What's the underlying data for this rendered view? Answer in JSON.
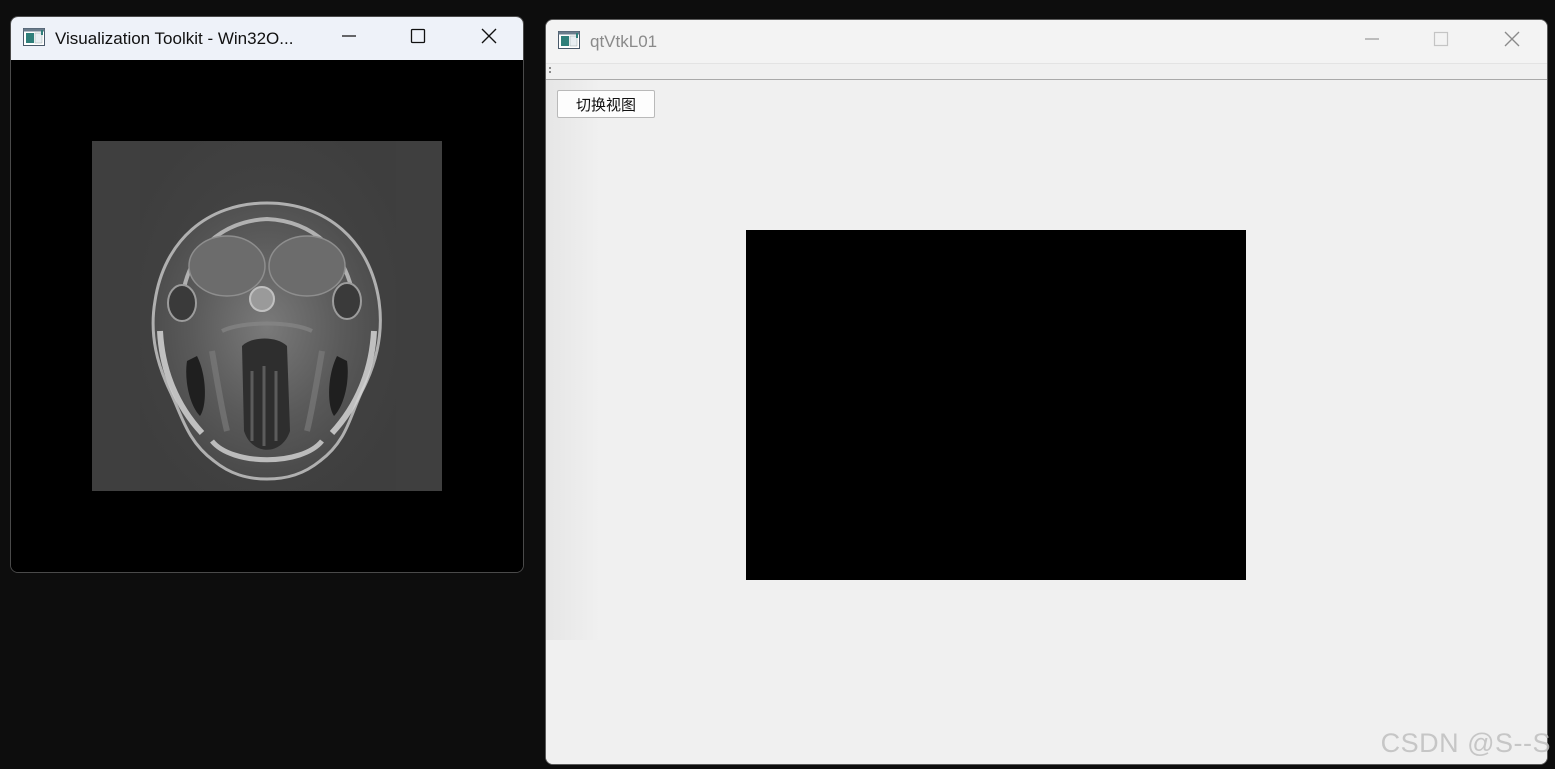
{
  "vtk_window": {
    "title": "Visualization Toolkit - Win32O...",
    "icon": "app-window-icon",
    "controls": {
      "minimize_icon": "minimize-icon",
      "maximize_icon": "maximize-icon",
      "close_icon": "close-icon"
    },
    "render_view": {
      "content": "MRI axial head slice",
      "background": "#000000"
    }
  },
  "qt_window": {
    "title": "qtVtkL01",
    "icon": "app-window-icon",
    "controls": {
      "minimize_icon": "minimize-icon",
      "maximize_icon": "maximize-icon",
      "close_icon": "close-icon"
    },
    "toolbar": {
      "grip_icon": "toolbar-grip-icon"
    },
    "central": {
      "switch_button_label": "切换视图",
      "vtk_widget_background": "#000000"
    }
  },
  "watermark": "CSDN @S--S",
  "colors": {
    "desktop": "#0d0d0d",
    "vtk_titlebar": "#eef2f9",
    "qt_background": "#f0f0f0",
    "qt_title_text": "#8a8a8a"
  }
}
